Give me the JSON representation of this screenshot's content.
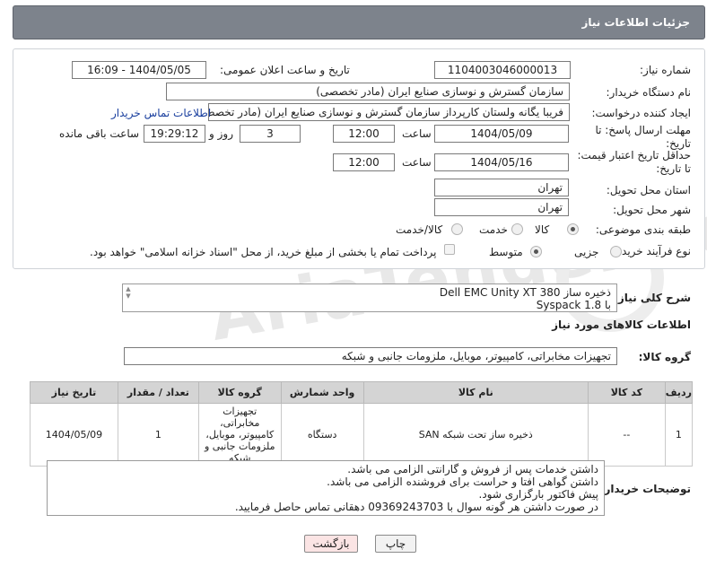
{
  "header": {
    "title": "جزئیات اطلاعات نیاز"
  },
  "labels": {
    "need_number": "شماره نیاز:",
    "announce_datetime": "تاریخ و ساعت اعلان عمومی:",
    "buyer_org": "نام دستگاه خریدار:",
    "requester": "ایجاد کننده درخواست:",
    "send_deadline": "مهلت ارسال پاسخ: تا تاریخ:",
    "hour": "ساعت",
    "days_and": "روز و",
    "remaining": "ساعت باقی مانده",
    "min_price_validity": "حداقل تاریخ اعتبار قیمت: تا تاریخ:",
    "delivery_province": "استان محل تحویل:",
    "delivery_city": "شهر محل تحویل:",
    "category": "طبقه بندی موضوعی:",
    "purchase_type": "نوع فرآیند خرید :",
    "description": "شرح کلی نیاز:",
    "goods_info": "اطلاعات کالاهای مورد نیاز",
    "goods_group": "گروه کالا:",
    "buyer_notes": "توضیحات خریدار:"
  },
  "fields": {
    "need_number": "1104003046000013",
    "announce_datetime": "1404/05/05 - 16:09",
    "buyer_org": "سازمان گسترش و نوسازی صنایع ایران (مادر تخصصی)",
    "requester": "فریبا یگانه ولستان کارپرداز سازمان گسترش و نوسازی صنایع ایران (مادر تخصصی)",
    "contact_link": "اطلاعات تماس خریدار",
    "send_date": "1404/05/09",
    "send_time": "12:00",
    "days": "3",
    "remaining_time": "19:29:12",
    "price_date": "1404/05/16",
    "price_time": "12:00",
    "province": "تهران",
    "city": "تهران",
    "goods_group": "تجهیزات مخابراتی، کامپیوتر، موبایل، ملزومات جانبی و شبکه"
  },
  "category_options": {
    "goods": "کالا",
    "service": "خدمت",
    "goods_service": "کالا/خدمت",
    "selected": "کالا"
  },
  "purchase_options": {
    "partial": "جزیی",
    "medium": "متوسط",
    "selected": "متوسط",
    "payment_note": "پرداخت تمام یا بخشی از مبلغ خرید، از محل \"اسناد خزانه اسلامی\" خواهد بود."
  },
  "description": {
    "line1": "ذخیره ساز Dell EMC Unity XT 380",
    "line2": "با Syspack 1.8"
  },
  "table": {
    "headers": [
      "ردیف",
      "کد کالا",
      "نام کالا",
      "واحد شمارش",
      "گروه کالا",
      "تعداد / مقدار",
      "تاریخ نیاز"
    ],
    "rows": [
      [
        "1",
        "--",
        "ذخیره ساز تحت شبکه SAN",
        "دستگاه",
        "تجهیزات مخابراتی، کامپیوتر، موبایل، ملزومات جانبی و شبکه",
        "1",
        "1404/05/09"
      ]
    ]
  },
  "notes": {
    "line1": "داشتن خدمات پس از فروش و گارانتی الزامی می باشد.",
    "line2": "داشتن گواهی افتا و حراست برای فروشنده الزامی می باشد.",
    "line3": "پیش فاکتور بارگزاری شود.",
    "line4": "در صورت داشتن هر گونه سوال با 09369243703 دهقانی تماس حاصل فرمایید."
  },
  "buttons": {
    "print": "چاپ",
    "back": "بازگشت"
  },
  "watermark": {
    "text": "AriaTender.neT"
  },
  "colors": {
    "header_bg": "#7d838c",
    "table_header_bg": "#d4d4d4",
    "link": "#1a3f9e",
    "back_button_bg": "#fbe4e4"
  }
}
